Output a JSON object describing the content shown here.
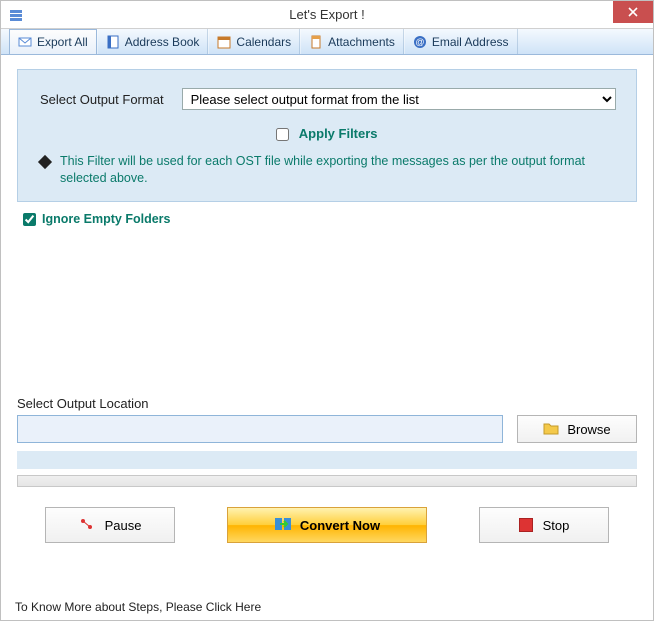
{
  "titlebar": {
    "title": "Let's Export !"
  },
  "tabs": {
    "t0": "Export All",
    "t1": "Address Book",
    "t2": "Calendars",
    "t3": "Attachments",
    "t4": "Email Address"
  },
  "panel": {
    "format_label": "Select Output Format",
    "format_placeholder": "Please select output format from the list",
    "apply_filters": "Apply Filters",
    "filter_note": "This Filter will be used for each OST file while exporting the messages as per the output format selected above.",
    "ignore_label": "Ignore Empty Folders",
    "ignore_checked": true
  },
  "output": {
    "label": "Select Output Location",
    "path": "",
    "browse": "Browse"
  },
  "buttons": {
    "pause": "Pause",
    "convert": "Convert Now",
    "stop": "Stop"
  },
  "footer": {
    "link": "To Know More about Steps, Please Click Here"
  }
}
